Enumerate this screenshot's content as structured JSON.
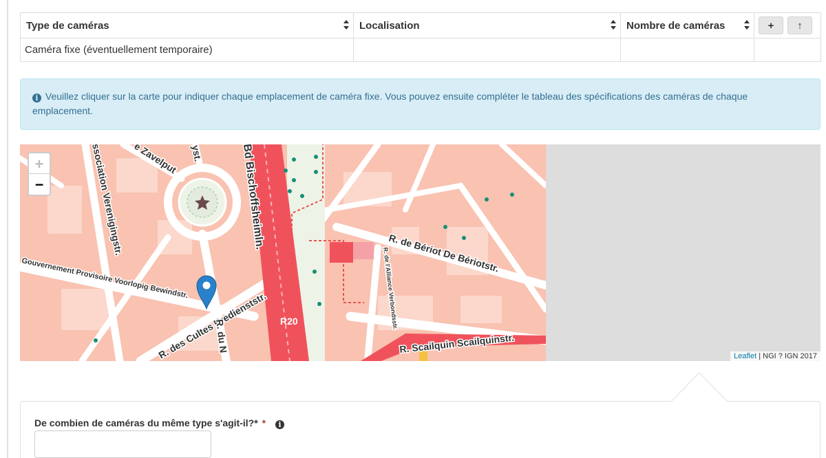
{
  "table": {
    "headers": [
      "Type de caméras",
      "Localisation",
      "Nombre de caméras"
    ],
    "add_button": "+",
    "up_button": "↑",
    "rows": [
      {
        "type": "Caméra fixe (éventuellement temporaire)",
        "location": "",
        "count": ""
      }
    ]
  },
  "info": {
    "text": "Veuillez cliquer sur la carte pour indiquer chaque emplacement de caméra fixe. Vous pouvez ensuite compléter le tableau des spécifications des caméras de chaque emplacement."
  },
  "map": {
    "zoom_in": "+",
    "zoom_out": "−",
    "attribution_link": "Leaflet",
    "attribution_text": " | NGI ? IGN 2017",
    "labels": {
      "zavelput": "e Zavelput",
      "yst": "yst.",
      "bischoffsheim": "Bd Bischoffsheimln.",
      "association": "ssociation Verenigingstr.",
      "gouvernement": "Gouvernement Provisoire Voorlopig Bewindstr.",
      "cultes": "R. des Cultes Eredienststr.",
      "du_n": "R. du N",
      "beriot": "R. de Bériot De Bériotstr.",
      "alliance": "R. de l'Alliance Verbondsstr.",
      "scailquin": "R. Scailquin Scailquinstr.",
      "r20": "R20"
    }
  },
  "question": {
    "label": "De combien de caméras du même type s'agit-il?*",
    "required_mark": "*",
    "value": ""
  },
  "colors": {
    "alert_bg": "#d9edf7",
    "alert_text": "#31708f",
    "map_building": "#f9c2b1",
    "map_road": "#ffffff",
    "map_highway": "#f0525c",
    "marker": "#2a81cb",
    "tree": "#148f77"
  }
}
